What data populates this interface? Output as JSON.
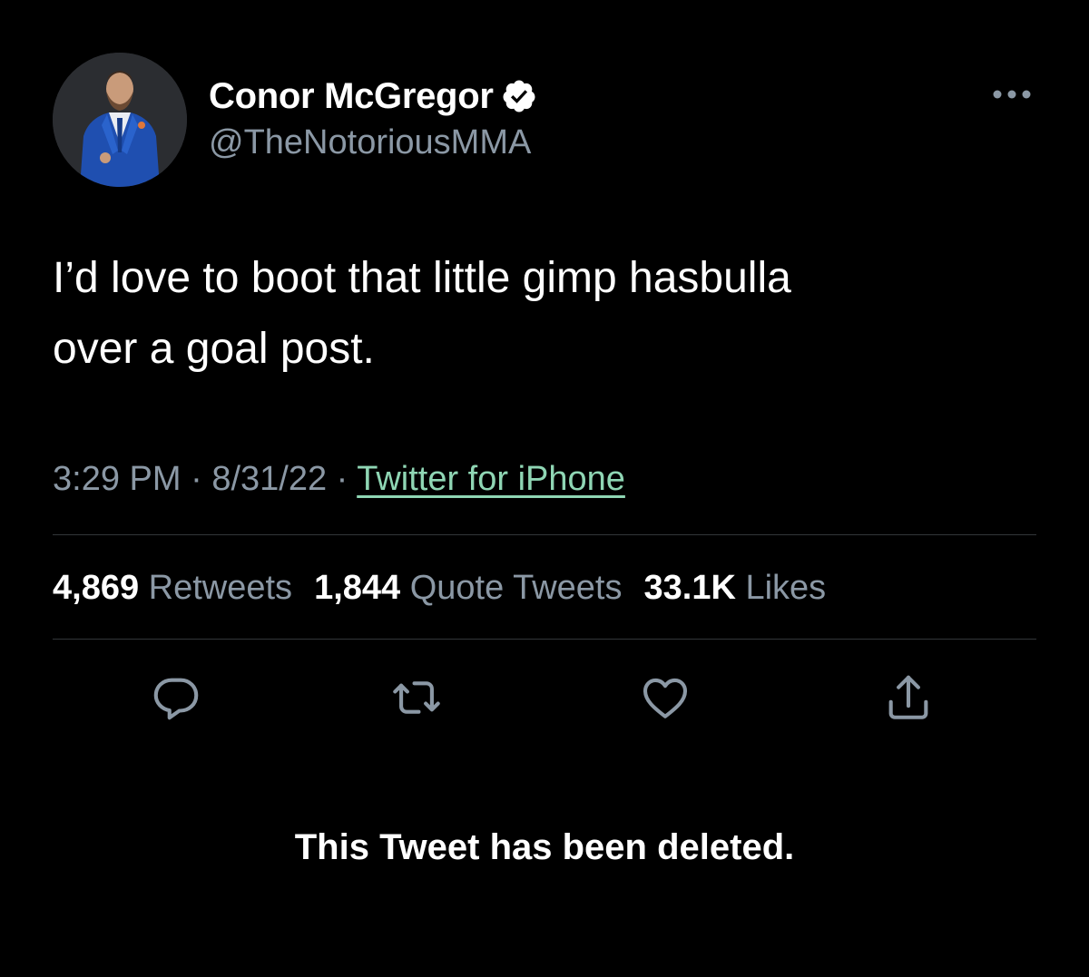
{
  "tweet": {
    "author": {
      "display_name": "Conor McGregor",
      "handle": "@TheNotoriousMMA",
      "verified": true,
      "avatar": "profile-photo"
    },
    "text_line1": "I’d love to boot that little gimp hasbulla",
    "text_line2": "over a goal post.",
    "time": "3:29 PM",
    "date": "8/31/22",
    "separator": "·",
    "source": "Twitter for iPhone",
    "stats": {
      "retweets_count": "4,869",
      "retweets_label": "Retweets",
      "quote_tweets_count": "1,844",
      "quote_tweets_label": "Quote Tweets",
      "likes_count": "33.1K",
      "likes_label": "Likes"
    },
    "actions": [
      "reply-icon",
      "retweet-icon",
      "like-icon",
      "share-icon"
    ]
  },
  "notice": "This Tweet has been deleted.",
  "colors": {
    "background": "#000000",
    "primary_text": "#ffffff",
    "secondary_text": "#8b98a5",
    "source_link": "#8fd6b4",
    "divider": "#333639"
  }
}
